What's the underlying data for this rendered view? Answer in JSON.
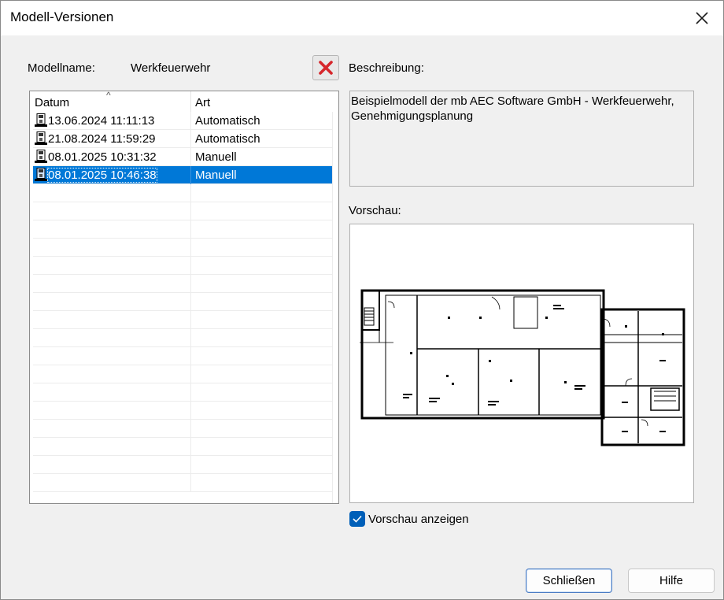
{
  "window": {
    "title": "Modell-Versionen"
  },
  "model": {
    "name_label": "Modellname:",
    "name_value": "Werkfeuerwehr"
  },
  "list": {
    "columns": [
      "Datum",
      "Art"
    ],
    "rows": [
      {
        "date": "13.06.2024 11:11:13",
        "type": "Automatisch",
        "selected": false
      },
      {
        "date": "21.08.2024 11:59:29",
        "type": "Automatisch",
        "selected": false
      },
      {
        "date": "08.01.2025 10:31:32",
        "type": "Manuell",
        "selected": false
      },
      {
        "date": "08.01.2025 10:46:38",
        "type": "Manuell",
        "selected": true
      }
    ]
  },
  "description": {
    "label": "Beschreibung:",
    "text": "Beispielmodell der mb AEC Software GmbH - Werkfeuerwehr, Genehmigungsplanung"
  },
  "preview": {
    "label": "Vorschau:",
    "show_label": "Vorschau anzeigen",
    "show_checked": true
  },
  "buttons": {
    "close": "Schließen",
    "help": "Hilfe"
  },
  "icons": {
    "window_close": "close-icon",
    "delete": "delete-x-icon",
    "row": "floppy-disk-icon",
    "checkbox": "checkmark-icon"
  },
  "colors": {
    "selection": "#0078d7",
    "delete_red": "#d6262b",
    "checkbox": "#005fb8"
  }
}
